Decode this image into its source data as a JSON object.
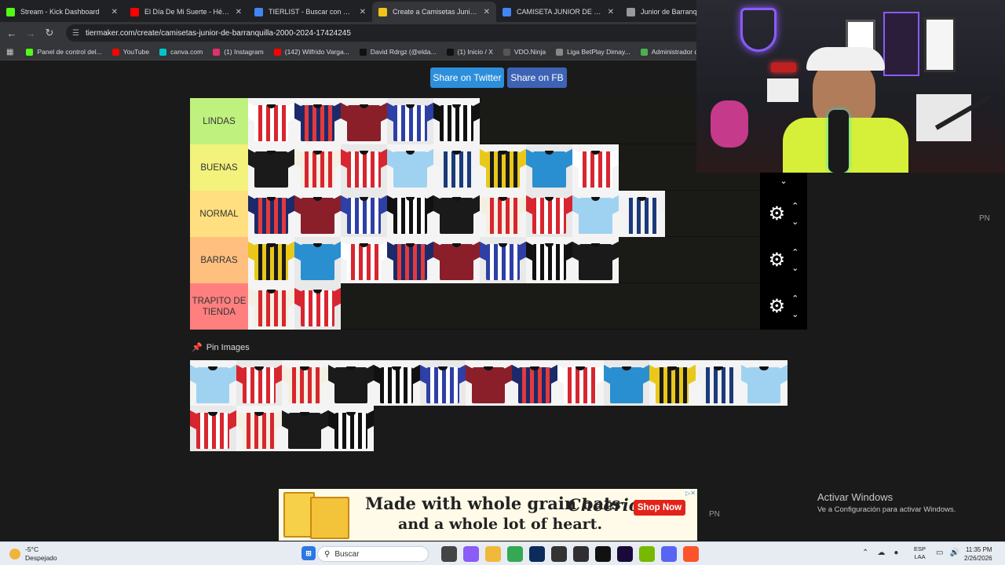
{
  "browser": {
    "tabs": [
      {
        "title": "Stream - Kick Dashboard",
        "icon": "kick-icon",
        "color": "#53fc18"
      },
      {
        "title": "El Día De Mi Suerte - Héctor La",
        "icon": "youtube-icon",
        "color": "#ff0000"
      },
      {
        "title": "TIERLIST - Buscar con Google",
        "icon": "google-icon",
        "color": "#4285f4"
      },
      {
        "title": "Create a Camisetas Junior de B",
        "icon": "tiermaker-icon",
        "color": "#f0c419"
      },
      {
        "title": "CAMISETA JUNIOR DE BARRANQ",
        "icon": "google-icon",
        "color": "#4285f4"
      },
      {
        "title": "Junior de Barranqu",
        "icon": "globe-icon",
        "color": "#999999"
      }
    ],
    "url": "tiermaker.com/create/camisetas-junior-de-barranquilla-2000-2024-17424245",
    "bookmarks": [
      {
        "label": "Panel de control del...",
        "icon": "kick-icon"
      },
      {
        "label": "YouTube",
        "icon": "youtube-icon"
      },
      {
        "label": "canva.com",
        "icon": "canva-icon"
      },
      {
        "label": "(1) Instagram",
        "icon": "instagram-icon"
      },
      {
        "label": "(142) Wilfrido Varga...",
        "icon": "youtube-icon"
      },
      {
        "label": "David Rdrgz (@elda...",
        "icon": "tiktok-icon"
      },
      {
        "label": "(1) Inicio / X",
        "icon": "x-icon"
      },
      {
        "label": "VDO.Ninja",
        "icon": "ninja-icon"
      },
      {
        "label": "Liga BetPlay Dimay...",
        "icon": "globe-icon"
      },
      {
        "label": "Administrador de e...",
        "icon": "puzzle-icon"
      }
    ]
  },
  "share": {
    "twitter": "Share on Twitter",
    "fb": "Share on FB"
  },
  "tiers": [
    {
      "label": "LINDAS",
      "color": "#bff17f",
      "count": 5
    },
    {
      "label": "BUENAS",
      "color": "#f2f27c",
      "count": 8
    },
    {
      "label": "NORMAL",
      "color": "#ffdf7f",
      "count": 9
    },
    {
      "label": "BARRAS",
      "color": "#ffbf7f",
      "count": 8
    },
    {
      "label": "TRAPITO DE TIENDA",
      "color": "#ff7f7f",
      "count": 2
    }
  ],
  "pin": {
    "label": "Pin Images"
  },
  "pool_count": 17,
  "ad": {
    "headline1": "Made with whole grain oats",
    "headline2": "and a whole lot of heart.",
    "brand": "Cheerios",
    "cta": "Shop Now"
  },
  "watermark": {
    "line1": "Activar Windows",
    "line2": "Ve a Configuración para activar Windows."
  },
  "pn": "PN",
  "taskbar": {
    "weather_temp": "-5°C",
    "weather_desc": "Despejado",
    "search_placeholder": "Buscar",
    "lang": "ESP",
    "lang2": "LAA",
    "time": "11:35 PM",
    "date": "2/26/2026"
  }
}
